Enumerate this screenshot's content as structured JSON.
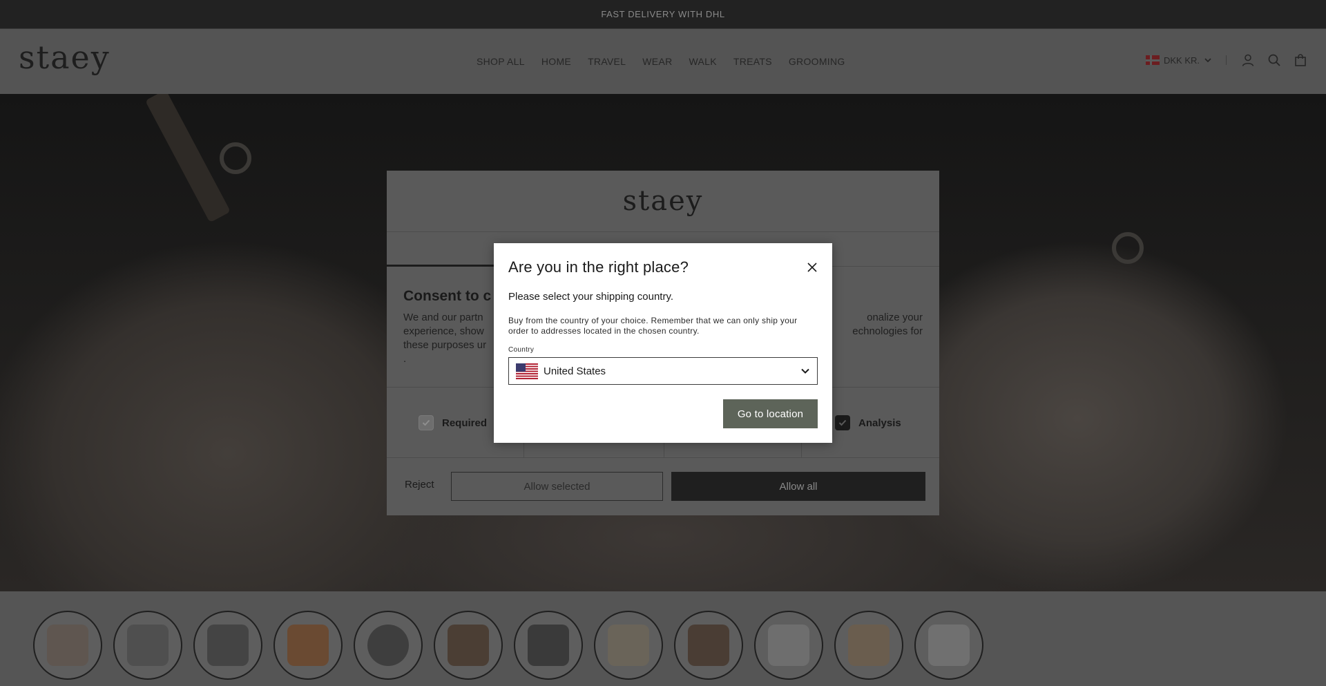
{
  "announcement": {
    "text": "FAST DELIVERY WITH DHL"
  },
  "header": {
    "logo": "staey",
    "nav": [
      {
        "label": "SHOP ALL"
      },
      {
        "label": "HOME"
      },
      {
        "label": "TRAVEL"
      },
      {
        "label": "WEAR"
      },
      {
        "label": "WALK"
      },
      {
        "label": "TREATS"
      },
      {
        "label": "GROOMING"
      }
    ],
    "currency": "DKK KR.",
    "icons": [
      "account-icon",
      "search-icon",
      "cart-icon"
    ]
  },
  "thumbnails": {
    "count": 12,
    "items": [
      "dog-in-bed",
      "travel-bag-grey",
      "tote-bag",
      "dog-in-harness",
      "leash",
      "dog-sitting",
      "bowls-set",
      "dog-bed-round",
      "feeding-mat",
      "dog-toy",
      "treats-bag",
      "grooming-tools"
    ]
  },
  "consent": {
    "logo": "staey",
    "title": "Consent to c",
    "text_line1": "We and our partn",
    "text_line1_end": "onalize your",
    "text_line2": "experience, show",
    "text_line2_end": "echnologies for",
    "text_line3": "these purposes ur",
    "text_line4": ".",
    "checks": {
      "required": "Required",
      "analysis": "Analysis"
    },
    "buttons": {
      "reject": "Reject",
      "allow_selected": "Allow selected",
      "allow_all": "Allow all"
    }
  },
  "location_dialog": {
    "title": "Are you in the right place?",
    "subtitle": "Please select your shipping country.",
    "description": "Buy from the country of your choice. Remember that we can only ship your order to addresses located in the chosen country.",
    "country_label": "Country",
    "country_value": "United States",
    "go_button": "Go to location"
  },
  "colors": {
    "go_button": "#5d6459",
    "allow_all_button": "#1f1f1f",
    "announcement_bg": "#222222"
  }
}
